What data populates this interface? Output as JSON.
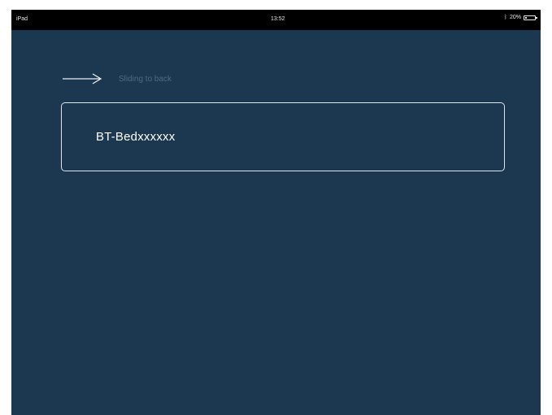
{
  "status_bar": {
    "device": "iPad",
    "time": "13:52",
    "bluetooth_icon": "bluetooth-icon",
    "battery_text": "20%",
    "battery_level": 0.2
  },
  "back": {
    "icon": "arrow-right-icon",
    "label": "Sliding to back"
  },
  "devices": [
    {
      "name": "BT-Bedxxxxxx"
    }
  ],
  "colors": {
    "background": "#1b3850",
    "status_bar": "#000000",
    "card_border": "#dfe6ec",
    "hint_text": "#4f6a83"
  }
}
